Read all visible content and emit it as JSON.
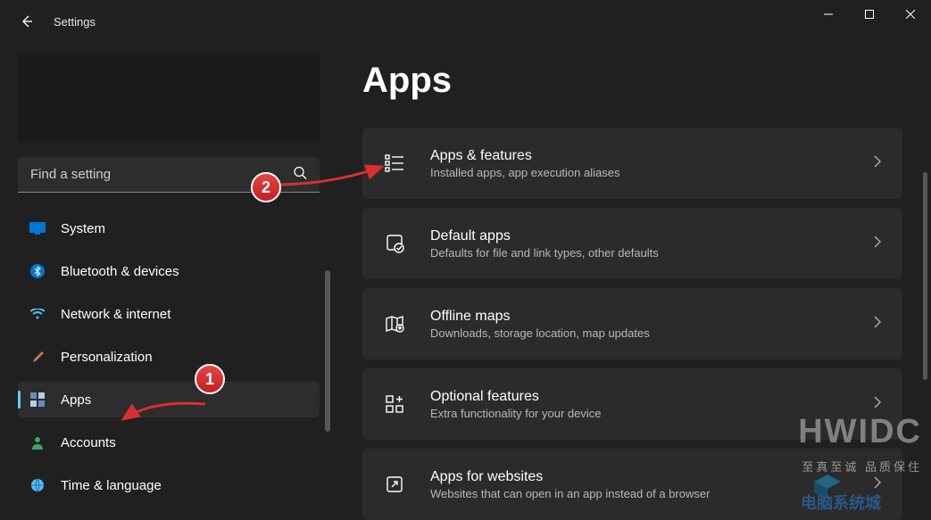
{
  "window": {
    "title": "Settings"
  },
  "search": {
    "placeholder": "Find a setting"
  },
  "sidebar": {
    "items": [
      {
        "label": "System"
      },
      {
        "label": "Bluetooth & devices"
      },
      {
        "label": "Network & internet"
      },
      {
        "label": "Personalization"
      },
      {
        "label": "Apps"
      },
      {
        "label": "Accounts"
      },
      {
        "label": "Time & language"
      }
    ]
  },
  "page": {
    "title": "Apps"
  },
  "cards": [
    {
      "title": "Apps & features",
      "sub": "Installed apps, app execution aliases"
    },
    {
      "title": "Default apps",
      "sub": "Defaults for file and link types, other defaults"
    },
    {
      "title": "Offline maps",
      "sub": "Downloads, storage location, map updates"
    },
    {
      "title": "Optional features",
      "sub": "Extra functionality for your device"
    },
    {
      "title": "Apps for websites",
      "sub": "Websites that can open in an app instead of a browser"
    }
  ],
  "annotations": {
    "badge1": "1",
    "badge2": "2"
  },
  "watermark": {
    "big": "HWIDC",
    "small": "至真至诚  品质保住"
  }
}
